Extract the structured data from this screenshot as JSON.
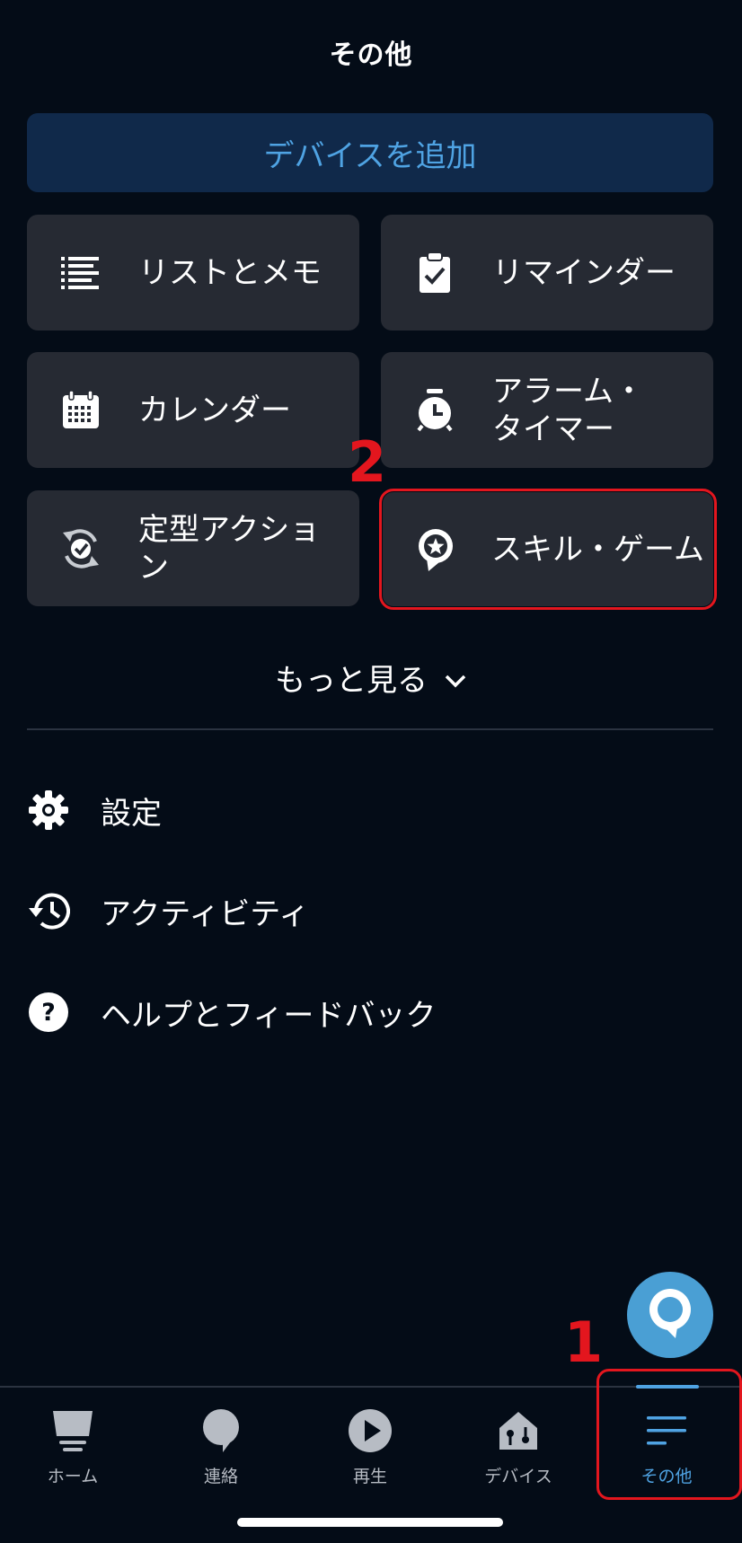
{
  "header": {
    "title": "その他"
  },
  "add_device": {
    "label": "デバイスを追加"
  },
  "tiles": [
    {
      "label": "リストとメモ",
      "icon": "list-icon"
    },
    {
      "label": "リマインダー",
      "icon": "reminder-clipboard-icon"
    },
    {
      "label": "カレンダー",
      "icon": "calendar-icon"
    },
    {
      "label": "アラーム・\nタイマー",
      "icon": "alarm-clock-icon"
    },
    {
      "label": "定型アクショ\nン",
      "icon": "routine-icon"
    },
    {
      "label": "スキル・ゲーム",
      "icon": "skills-star-icon"
    }
  ],
  "see_more": {
    "label": "もっと見る",
    "icon": "chevron-down-icon"
  },
  "menu": [
    {
      "label": "設定",
      "icon": "gear-icon"
    },
    {
      "label": "アクティビティ",
      "icon": "history-icon"
    },
    {
      "label": "ヘルプとフィードバック",
      "icon": "help-icon"
    }
  ],
  "tabbar": {
    "tabs": [
      {
        "label": "ホーム",
        "icon": "home-icon"
      },
      {
        "label": "連絡",
        "icon": "chat-bubble-icon"
      },
      {
        "label": "再生",
        "icon": "play-icon"
      },
      {
        "label": "デバイス",
        "icon": "devices-house-icon"
      },
      {
        "label": "その他",
        "icon": "menu-lines-icon",
        "active": true
      }
    ]
  },
  "annotations": {
    "step1": "1",
    "step2": "2"
  },
  "colors": {
    "background": "#040c17",
    "accent": "#4fa3e3",
    "tile": "#262a33",
    "annotation": "#e3161e"
  }
}
